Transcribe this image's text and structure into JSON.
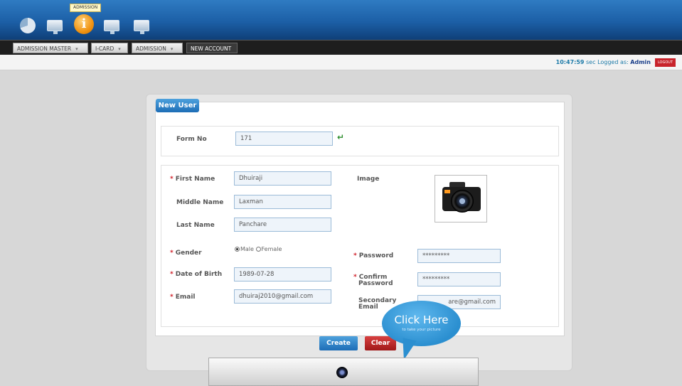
{
  "header": {
    "tooltip": "ADMISSION",
    "icons": [
      "pie-chart-icon",
      "monitor-icon",
      "info-icon",
      "monitor-icon",
      "monitor-icon"
    ]
  },
  "tabs": [
    {
      "label": "ADMISSION MASTER"
    },
    {
      "label": "I-CARD"
    },
    {
      "label": "ADMISSION"
    },
    {
      "label": "NEW ACCOUNT"
    }
  ],
  "status": {
    "time": "10:47:59",
    "unit": "sec",
    "logged_as_label": "Logged as:",
    "user": "Admin",
    "logout": "LOGOUT"
  },
  "form": {
    "title": "New User",
    "form_no_label": "Form No",
    "form_no_value": "171",
    "first_name_label": "First Name",
    "first_name_value": "Dhuiraji",
    "middle_name_label": "Middle Name",
    "middle_name_value": "Laxman",
    "last_name_label": "Last Name",
    "last_name_value": "Panchare",
    "image_label": "Image",
    "gender_label": "Gender",
    "gender_male": "Male",
    "gender_female": "Female",
    "gender_selected": "Male",
    "dob_label": "Date of Birth",
    "dob_value": "1989-07-28",
    "email_label": "Email",
    "email_value": "dhuiraj2010@gmail.com",
    "password_label": "Password",
    "password_value": "*********",
    "confirm_password_label_1": "Confirm",
    "confirm_password_label_2": "Password",
    "confirm_password_value": "*********",
    "secondary_email_label_1": "Secondary",
    "secondary_email_label_2": "Email",
    "secondary_email_value": "are@gmail.com",
    "create_button": "Create",
    "clear_button": "Clear"
  },
  "bubble": {
    "title": "Click Here",
    "subtitle": "to take your picture"
  },
  "colors": {
    "banner": "#1c5fa6",
    "accent_blue": "#1d6db6",
    "danger_red": "#c8232b"
  }
}
